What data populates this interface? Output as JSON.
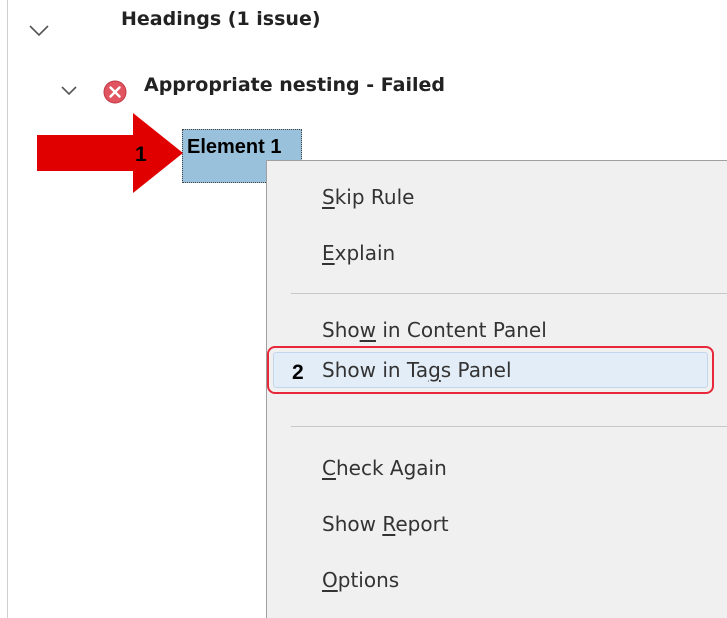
{
  "tree": {
    "headings_label": "Headings (1 issue)",
    "rule_label": "Appropriate nesting - Failed",
    "element_label": "Element 1",
    "rule_status_icon": "error-x-icon",
    "expand_icon": "chevron-down-icon"
  },
  "annotations": {
    "step1": "1",
    "step2": "2"
  },
  "context_menu": {
    "items": [
      {
        "pre": "",
        "u": "S",
        "post": "kip Rule"
      },
      {
        "pre": "",
        "u": "E",
        "post": "xplain"
      },
      {
        "pre": "Sho",
        "u": "w",
        "post": " in Content Panel"
      },
      {
        "pre": "Show in Ta",
        "u": "g",
        "post": "s Panel"
      },
      {
        "pre": "",
        "u": "C",
        "post": "heck Again"
      },
      {
        "pre": "Show ",
        "u": "R",
        "post": "eport"
      },
      {
        "pre": "",
        "u": "O",
        "post": "ptions"
      }
    ]
  },
  "colors": {
    "selection": "#99c1db",
    "highlight_border": "#e8283a",
    "arrow": "#e00000",
    "error_icon": "#e05560"
  }
}
